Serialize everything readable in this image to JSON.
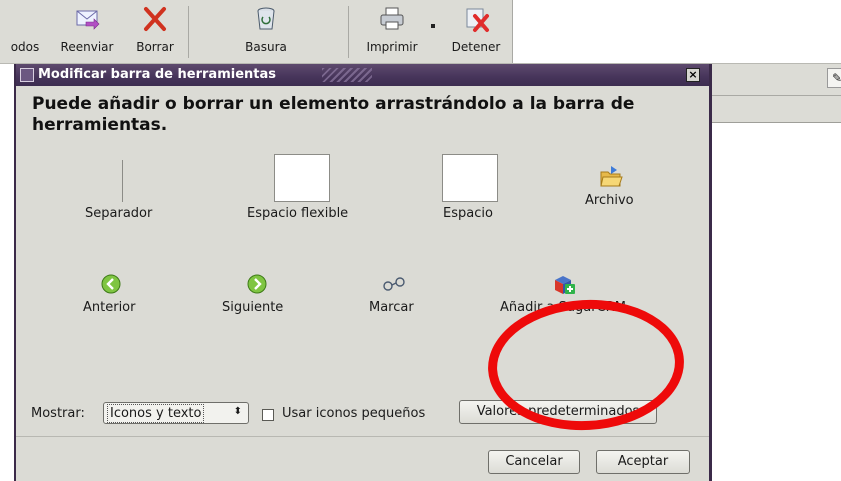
{
  "toolbar": {
    "todos_label": "odos",
    "reenviar_label": "Reenviar",
    "borrar_label": "Borrar",
    "basura_label": "Basura",
    "imprimir_label": "Imprimir",
    "detener_label": "Detener"
  },
  "dialog": {
    "title": "Modificar barra de herramientas",
    "close_glyph": "×",
    "instruction": "Puede añadir o borrar un elemento arrastrándolo a la barra de herramientas.",
    "items": {
      "separador": "Separador",
      "espacio_flexible": "Espacio flexible",
      "espacio": "Espacio",
      "archivo": "Archivo",
      "anterior": "Anterior",
      "siguiente": "Siguiente",
      "marcar": "Marcar",
      "sugarcrm": "Añadir a SugarCRM"
    },
    "mostrar_label": "Mostrar:",
    "mostrar_value": "Iconos y texto",
    "usar_iconos_label": "Usar iconos pequeños",
    "usar_iconos_checked": false,
    "defaults_button": "Valores predeterminados",
    "cancel_button": "Cancelar",
    "accept_button": "Aceptar"
  },
  "annotation": {
    "color": "#ee0a0a"
  }
}
